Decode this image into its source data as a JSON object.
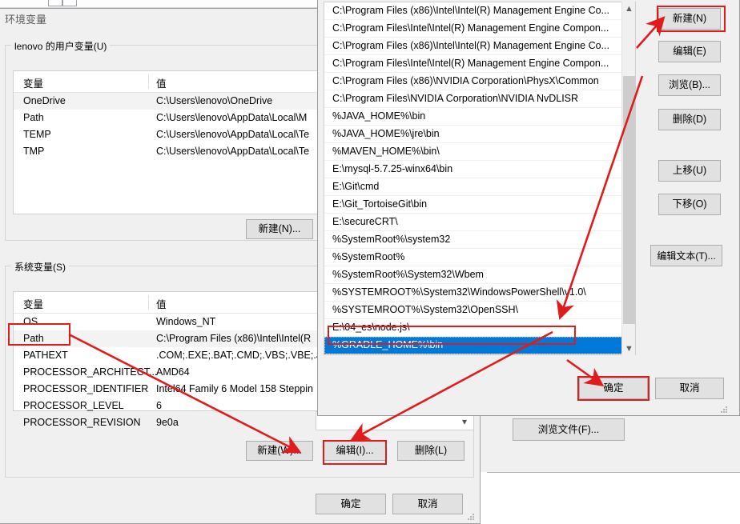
{
  "env_dialog": {
    "title": "环境变量",
    "user_group_label": "lenovo 的用户变量(U)",
    "system_group_label": "系统变量(S)",
    "columns": {
      "name": "变量",
      "value": "值"
    },
    "user_rows": [
      {
        "name": "OneDrive",
        "value": "C:\\Users\\lenovo\\OneDrive"
      },
      {
        "name": "Path",
        "value": "C:\\Users\\lenovo\\AppData\\Local\\M"
      },
      {
        "name": "TEMP",
        "value": "C:\\Users\\lenovo\\AppData\\Local\\Te"
      },
      {
        "name": "TMP",
        "value": "C:\\Users\\lenovo\\AppData\\Local\\Te"
      }
    ],
    "system_rows": [
      {
        "name": "OS",
        "value": "Windows_NT"
      },
      {
        "name": "Path",
        "value": "C:\\Program Files (x86)\\Intel\\Intel(R"
      },
      {
        "name": "PATHEXT",
        "value": ".COM;.EXE;.BAT;.CMD;.VBS;.VBE;.JS"
      },
      {
        "name": "PROCESSOR_ARCHITECT...",
        "value": "AMD64"
      },
      {
        "name": "PROCESSOR_IDENTIFIER",
        "value": "Intel64 Family 6 Model 158 Steppin"
      },
      {
        "name": "PROCESSOR_LEVEL",
        "value": "6"
      },
      {
        "name": "PROCESSOR_REVISION",
        "value": "9e0a"
      }
    ],
    "user_new_button": "新建(N)...",
    "system_new_button": "新建(W)...",
    "system_edit_button": "编辑(I)...",
    "system_delete_button": "删除(L)",
    "ok_button": "确定",
    "cancel_button": "取消",
    "scroll_down_icon": "chevron-down-icon"
  },
  "edit_dialog": {
    "path_entries": [
      "C:\\Program Files (x86)\\Intel\\Intel(R) Management Engine Co...",
      "C:\\Program Files\\Intel\\Intel(R) Management Engine Compon...",
      "C:\\Program Files (x86)\\Intel\\Intel(R) Management Engine Co...",
      "C:\\Program Files\\Intel\\Intel(R) Management Engine Compon...",
      "C:\\Program Files (x86)\\NVIDIA Corporation\\PhysX\\Common",
      "C:\\Program Files\\NVIDIA Corporation\\NVIDIA NvDLISR",
      "%JAVA_HOME%\\bin",
      "%JAVA_HOME%\\jre\\bin",
      "%MAVEN_HOME%\\bin\\",
      "E:\\mysql-5.7.25-winx64\\bin",
      "E:\\Git\\cmd",
      "E:\\Git_TortoiseGit\\bin",
      "E:\\secureCRT\\",
      "%SystemRoot%\\system32",
      "%SystemRoot%",
      "%SystemRoot%\\System32\\Wbem",
      "%SYSTEMROOT%\\System32\\WindowsPowerShell\\v1.0\\",
      "%SYSTEMROOT%\\System32\\OpenSSH\\",
      "E:\\04_es\\node.js\\",
      "%GRADLE_HOME%\\bin"
    ],
    "selected_index": 19,
    "side_buttons": [
      {
        "label": "新建(N)",
        "name": "new-button"
      },
      {
        "label": "编辑(E)",
        "name": "edit-button"
      },
      {
        "label": "浏览(B)...",
        "name": "browse-button"
      },
      {
        "label": "删除(D)",
        "name": "delete-button"
      },
      {
        "label": "上移(U)",
        "name": "move-up-button"
      },
      {
        "label": "下移(O)",
        "name": "move-down-button"
      },
      {
        "label": "编辑文本(T)...",
        "name": "edit-text-button"
      }
    ],
    "ok_button": "确定",
    "cancel_button": "取消",
    "scroll_up_icon": "chevron-up-icon",
    "scroll_down_icon": "chevron-down-icon"
  },
  "browse_panel": {
    "browse_file_button": "浏览文件(F)..."
  },
  "annotations": {
    "color": "#e01b1b",
    "highlight_boxes": [
      "new-side-button",
      "selected-path-entry",
      "system-path-row",
      "system-edit-button",
      "edit-dialog-ok-button"
    ]
  }
}
